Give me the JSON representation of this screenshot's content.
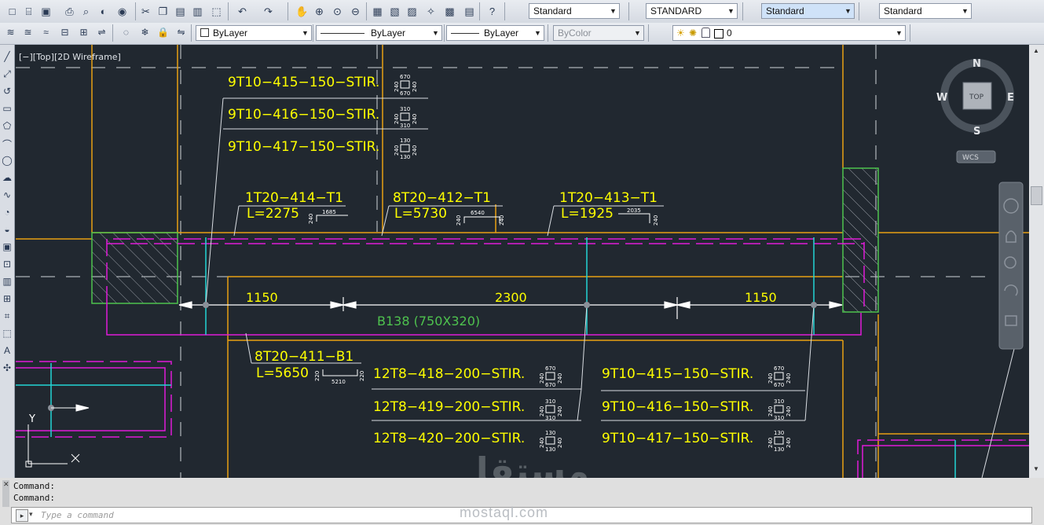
{
  "toolbar": {
    "text_style": "Standard",
    "dim_style": "STANDARD",
    "table_style": "Standard",
    "mleader_style": "Standard",
    "layer_color": "ByLayer",
    "linetype": "ByLayer",
    "lineweight": "ByLayer",
    "plot_style": "ByColor",
    "layer_name": "0"
  },
  "viewport": {
    "label": "[−][Top][2D Wireframe]"
  },
  "viewcube": {
    "north": "N",
    "south": "S",
    "east": "E",
    "west": "W",
    "top": "TOP",
    "wcs": "WCS"
  },
  "ucs": {
    "y": "Y"
  },
  "drawing": {
    "stirrups_top": [
      "9T10−415−150−STIR.",
      "9T10−416−150−STIR.",
      "9T10−417−150−STIR."
    ],
    "stirrups_bot_left": [
      "12T8−418−200−STIR.",
      "12T8−419−200−STIR.",
      "12T8−420−200−STIR."
    ],
    "stirrups_bot_right": [
      "9T10−415−150−STIR.",
      "9T10−416−150−STIR.",
      "9T10−417−150−STIR."
    ],
    "bar_414": {
      "mark": "1T20−414−T1",
      "length": "L=2275",
      "leg": "240",
      "straight": "1685"
    },
    "bar_412": {
      "mark": "8T20−412−T1",
      "length": "L=5730",
      "leg": "240",
      "straight": "6540",
      "leg2": "240"
    },
    "bar_413": {
      "mark": "1T20−413−T1",
      "length": "L=1925",
      "straight": "2035",
      "leg": "240"
    },
    "bar_411": {
      "mark": "8T20−411−B1",
      "length": "L=5650",
      "leg": "220",
      "straight": "5210",
      "leg2": "220"
    },
    "shape_dims": {
      "s1": {
        "top": "670",
        "side1": "240",
        "side2": "240",
        "bottom": "670"
      },
      "s2": {
        "top": "310",
        "side1": "240",
        "side2": "240",
        "bottom": "310"
      },
      "s3": {
        "top": "130",
        "side1": "240",
        "side2": "240",
        "bottom": "130"
      }
    },
    "dims": [
      "1150",
      "2300",
      "1150"
    ],
    "beam_label": "B138 (750X320)"
  },
  "command": {
    "history": [
      "Command:",
      "Command:"
    ],
    "placeholder": "Type a command"
  },
  "watermark": {
    "arabic": "مستقل",
    "latin": "mostaql.com"
  },
  "colors": {
    "background": "#212830",
    "text_yellow": "#ffff00",
    "beam_green": "#4ec24e",
    "magenta": "#e01ad8",
    "orange": "#e8a012",
    "cyan": "#22d6d6"
  },
  "icons": {
    "row1": [
      "new-icon",
      "open-icon",
      "save-icon",
      "print-icon",
      "preview-icon",
      "publish-icon",
      "3d-print-icon",
      "cut-icon",
      "copy-icon",
      "paste-icon",
      "paste-special-icon",
      "match-properties-icon",
      "undo-icon",
      "redo-icon",
      "pan-icon",
      "zoom-realtime-icon",
      "zoom-window-icon",
      "zoom-previous-icon",
      "properties-icon",
      "design-center-icon",
      "tool-palettes-icon",
      "sheet-set-icon",
      "markup-icon",
      "calculator-icon",
      "help-icon"
    ],
    "row2": [
      "layer-properties-icon",
      "layer-state-icon",
      "layer-previous-icon",
      "layer-isolate-icon",
      "layer-unisolate-icon",
      "match-layer-icon",
      "layer-off-icon",
      "layer-freeze-icon",
      "layer-lock-icon",
      "layer-walk-icon"
    ]
  }
}
